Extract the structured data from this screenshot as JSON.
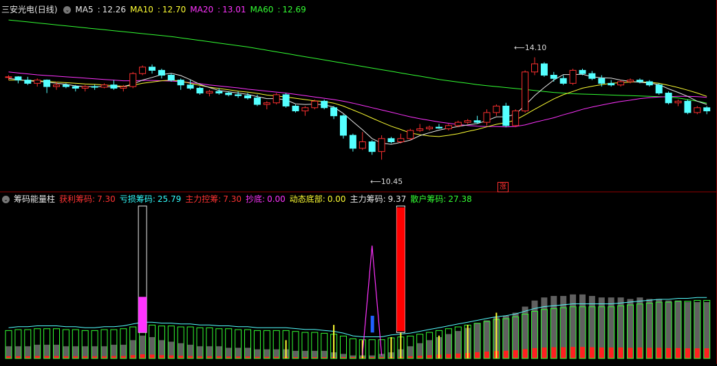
{
  "top_header": {
    "stock": "三安光电",
    "period": "(日线)",
    "ma": [
      {
        "name": "MA5",
        "value": "12.26",
        "color": "#e8e8e8"
      },
      {
        "name": "MA10",
        "value": "12.70",
        "color": "#ffff33"
      },
      {
        "name": "MA20",
        "value": "13.01",
        "color": "#ff33ff"
      },
      {
        "name": "MA60",
        "value": "12.69",
        "color": "#33ff33"
      }
    ]
  },
  "bottom_header": {
    "indicator": "筹码能量柱",
    "items": [
      {
        "name": "获利筹码",
        "value": "7.30",
        "color": "#ff3333"
      },
      {
        "name": "亏损筹码",
        "value": "25.79",
        "color": "#33ffff"
      },
      {
        "name": "主力控筹",
        "value": "7.30",
        "color": "#ff3333"
      },
      {
        "name": "抄底",
        "value": "0.00",
        "color": "#ff33ff"
      },
      {
        "name": "动态底部",
        "value": "0.00",
        "color": "#ffff33"
      },
      {
        "name": "主力筹码",
        "value": "9.37",
        "color": "#e8e8e8"
      },
      {
        "name": "散户筹码",
        "value": "27.38",
        "color": "#33ff33"
      }
    ]
  },
  "annotations": {
    "high_label": "14.10",
    "low_label": "10.45",
    "limit_up_badge": "涨"
  },
  "colors": {
    "up": "#ff3030",
    "down": "#54ffff",
    "ma5": "#e8e8e8",
    "ma10": "#ffff33",
    "ma20": "#ff33ff",
    "ma60": "#33ff33",
    "divider": "#8a0000"
  },
  "chart_data": {
    "type": "candlestick",
    "y_range": [
      10.2,
      15.4
    ],
    "candles": [
      [
        13.5,
        13.55,
        13.4,
        13.5
      ],
      [
        13.5,
        13.52,
        13.3,
        13.4
      ],
      [
        13.4,
        13.5,
        13.25,
        13.3
      ],
      [
        13.3,
        13.45,
        13.2,
        13.4
      ],
      [
        13.4,
        13.42,
        13.0,
        13.2
      ],
      [
        13.2,
        13.35,
        13.1,
        13.25
      ],
      [
        13.25,
        13.3,
        13.15,
        13.2
      ],
      [
        13.2,
        13.25,
        13.05,
        13.15
      ],
      [
        13.15,
        13.25,
        13.05,
        13.2
      ],
      [
        13.2,
        13.26,
        13.1,
        13.18
      ],
      [
        13.18,
        13.3,
        13.15,
        13.25
      ],
      [
        13.25,
        13.4,
        13.1,
        13.15
      ],
      [
        13.15,
        13.25,
        13.05,
        13.2
      ],
      [
        13.2,
        13.65,
        13.15,
        13.6
      ],
      [
        13.6,
        13.85,
        13.55,
        13.8
      ],
      [
        13.8,
        13.88,
        13.6,
        13.7
      ],
      [
        13.7,
        13.75,
        13.45,
        13.55
      ],
      [
        13.55,
        13.6,
        13.35,
        13.4
      ],
      [
        13.4,
        13.45,
        13.1,
        13.25
      ],
      [
        13.25,
        13.4,
        13.1,
        13.15
      ],
      [
        13.15,
        13.2,
        12.95,
        13.0
      ],
      [
        13.0,
        13.1,
        12.9,
        13.05
      ],
      [
        13.05,
        13.15,
        12.95,
        13.0
      ],
      [
        13.0,
        13.05,
        12.9,
        12.95
      ],
      [
        12.95,
        13.05,
        12.85,
        12.92
      ],
      [
        12.92,
        13.0,
        12.8,
        12.85
      ],
      [
        12.85,
        12.95,
        12.6,
        12.65
      ],
      [
        12.65,
        12.75,
        12.5,
        12.7
      ],
      [
        12.7,
        13.0,
        12.65,
        12.95
      ],
      [
        12.95,
        13.0,
        12.55,
        12.6
      ],
      [
        12.6,
        12.65,
        12.4,
        12.45
      ],
      [
        12.45,
        12.6,
        12.3,
        12.55
      ],
      [
        12.55,
        12.8,
        12.5,
        12.75
      ],
      [
        12.75,
        12.8,
        12.5,
        12.55
      ],
      [
        12.55,
        12.6,
        12.2,
        12.3
      ],
      [
        12.3,
        12.35,
        11.6,
        11.7
      ],
      [
        11.7,
        11.75,
        11.2,
        11.3
      ],
      [
        11.3,
        11.8,
        11.25,
        11.5
      ],
      [
        11.5,
        11.55,
        11.1,
        11.2
      ],
      [
        11.2,
        11.7,
        10.95,
        11.6
      ],
      [
        11.6,
        11.65,
        11.45,
        11.5
      ],
      [
        11.5,
        11.75,
        11.45,
        11.6
      ],
      [
        11.6,
        11.9,
        11.55,
        11.85
      ],
      [
        11.85,
        12.05,
        11.8,
        11.9
      ],
      [
        11.9,
        12.0,
        11.85,
        11.95
      ],
      [
        11.95,
        12.05,
        11.9,
        11.92
      ],
      [
        11.9,
        12.05,
        11.85,
        12.0
      ],
      [
        12.0,
        12.15,
        11.95,
        12.1
      ],
      [
        12.1,
        12.2,
        12.05,
        12.15
      ],
      [
        12.15,
        12.3,
        12.05,
        12.1
      ],
      [
        12.1,
        12.5,
        12.0,
        12.4
      ],
      [
        12.4,
        12.65,
        12.3,
        12.6
      ],
      [
        12.6,
        12.7,
        11.95,
        12.0
      ],
      [
        12.0,
        12.5,
        11.95,
        12.45
      ],
      [
        12.45,
        13.7,
        12.4,
        13.65
      ],
      [
        13.65,
        14.1,
        13.55,
        13.9
      ],
      [
        13.9,
        13.95,
        13.5,
        13.55
      ],
      [
        13.55,
        13.65,
        13.35,
        13.45
      ],
      [
        13.45,
        13.55,
        13.25,
        13.3
      ],
      [
        13.3,
        13.75,
        13.25,
        13.7
      ],
      [
        13.7,
        13.75,
        13.55,
        13.6
      ],
      [
        13.6,
        13.68,
        13.4,
        13.45
      ],
      [
        13.45,
        13.55,
        13.2,
        13.3
      ],
      [
        13.3,
        13.4,
        13.2,
        13.25
      ],
      [
        13.25,
        13.4,
        13.2,
        13.35
      ],
      [
        13.35,
        13.45,
        13.3,
        13.4
      ],
      [
        13.4,
        13.45,
        13.3,
        13.35
      ],
      [
        13.35,
        13.4,
        13.2,
        13.25
      ],
      [
        13.25,
        13.3,
        12.95,
        13.0
      ],
      [
        13.0,
        13.05,
        12.65,
        12.7
      ],
      [
        12.7,
        12.8,
        12.6,
        12.75
      ],
      [
        12.75,
        12.8,
        12.35,
        12.4
      ],
      [
        12.4,
        12.6,
        12.35,
        12.55
      ],
      [
        12.55,
        12.6,
        12.35,
        12.45
      ]
    ],
    "ma5": [
      13.45,
      13.42,
      13.38,
      13.36,
      13.34,
      13.3,
      13.27,
      13.22,
      13.2,
      13.2,
      13.2,
      13.19,
      13.2,
      13.28,
      13.4,
      13.48,
      13.57,
      13.61,
      13.54,
      13.41,
      13.27,
      13.17,
      13.08,
      13.04,
      13.0,
      12.96,
      12.89,
      12.83,
      12.83,
      12.79,
      12.67,
      12.65,
      12.66,
      12.64,
      12.57,
      12.37,
      12.12,
      11.87,
      11.6,
      11.46,
      11.42,
      11.48,
      11.55,
      11.69,
      11.78,
      11.86,
      11.92,
      11.97,
      12.02,
      12.06,
      12.15,
      12.27,
      12.27,
      12.35,
      12.62,
      12.92,
      13.17,
      13.4,
      13.57,
      13.57,
      13.58,
      13.5,
      13.47,
      13.46,
      13.4,
      13.36,
      13.33,
      13.31,
      13.26,
      13.13,
      13.02,
      12.9,
      12.75,
      12.65
    ],
    "ma10": [
      13.4,
      13.4,
      13.39,
      13.38,
      13.36,
      13.34,
      13.32,
      13.3,
      13.28,
      13.27,
      13.25,
      13.23,
      13.21,
      13.24,
      13.3,
      13.34,
      13.38,
      13.4,
      13.37,
      13.3,
      13.24,
      13.18,
      13.14,
      13.1,
      13.06,
      13.03,
      12.99,
      12.94,
      12.91,
      12.88,
      12.84,
      12.8,
      12.76,
      12.74,
      12.69,
      12.6,
      12.48,
      12.36,
      12.23,
      12.1,
      11.98,
      11.88,
      11.77,
      11.72,
      11.68,
      11.66,
      11.7,
      11.75,
      11.82,
      11.88,
      11.96,
      12.04,
      12.09,
      12.17,
      12.33,
      12.5,
      12.66,
      12.82,
      12.95,
      13.05,
      13.15,
      13.21,
      13.26,
      13.3,
      13.32,
      13.34,
      13.35,
      13.33,
      13.3,
      13.24,
      13.17,
      13.09,
      13.0,
      12.9
    ],
    "ma20": [
      13.65,
      13.62,
      13.59,
      13.56,
      13.54,
      13.52,
      13.5,
      13.48,
      13.46,
      13.44,
      13.42,
      13.4,
      13.38,
      13.38,
      13.39,
      13.39,
      13.38,
      13.37,
      13.35,
      13.32,
      13.29,
      13.25,
      13.22,
      13.19,
      13.16,
      13.12,
      13.09,
      13.06,
      13.03,
      13.0,
      12.96,
      12.92,
      12.88,
      12.84,
      12.8,
      12.75,
      12.69,
      12.62,
      12.55,
      12.48,
      12.41,
      12.34,
      12.27,
      12.21,
      12.16,
      12.11,
      12.07,
      12.03,
      12.0,
      11.98,
      11.97,
      11.97,
      11.96,
      11.97,
      12.02,
      12.1,
      12.17,
      12.24,
      12.33,
      12.41,
      12.5,
      12.57,
      12.63,
      12.69,
      12.74,
      12.78,
      12.83,
      12.86,
      12.88,
      12.89,
      12.9,
      12.9,
      12.89,
      12.87
    ],
    "ma60": [
      15.25,
      15.22,
      15.19,
      15.16,
      15.13,
      15.1,
      15.07,
      15.04,
      15.01,
      14.98,
      14.95,
      14.92,
      14.89,
      14.86,
      14.83,
      14.8,
      14.77,
      14.74,
      14.7,
      14.66,
      14.62,
      14.58,
      14.54,
      14.5,
      14.46,
      14.42,
      14.37,
      14.32,
      14.27,
      14.22,
      14.17,
      14.12,
      14.07,
      14.02,
      13.97,
      13.92,
      13.87,
      13.82,
      13.77,
      13.72,
      13.67,
      13.62,
      13.57,
      13.52,
      13.47,
      13.42,
      13.38,
      13.34,
      13.3,
      13.26,
      13.23,
      13.2,
      13.17,
      13.14,
      13.11,
      13.08,
      13.05,
      13.02,
      13.0,
      12.98,
      12.97,
      12.96,
      12.95,
      12.94,
      12.93,
      12.92,
      12.91,
      12.9,
      12.89,
      12.88,
      12.85,
      12.8,
      12.75,
      12.69
    ],
    "volume_boxes": [
      0.32,
      0.33,
      0.33,
      0.34,
      0.34,
      0.34,
      0.33,
      0.33,
      0.32,
      0.32,
      0.33,
      0.33,
      0.34,
      0.36,
      0.38,
      0.38,
      0.37,
      0.37,
      0.36,
      0.36,
      0.35,
      0.35,
      0.34,
      0.34,
      0.33,
      0.33,
      0.32,
      0.32,
      0.32,
      0.32,
      0.31,
      0.3,
      0.3,
      0.29,
      0.28,
      0.26,
      0.23,
      0.22,
      0.22,
      0.22,
      0.24,
      0.25,
      0.26,
      0.28,
      0.3,
      0.32,
      0.34,
      0.36,
      0.38,
      0.4,
      0.42,
      0.44,
      0.45,
      0.47,
      0.5,
      0.53,
      0.55,
      0.56,
      0.57,
      0.58,
      0.58,
      0.58,
      0.58,
      0.58,
      0.59,
      0.6,
      0.61,
      0.62,
      0.63,
      0.63,
      0.64,
      0.64,
      0.65,
      0.65
    ],
    "gray_fill": [
      0.08,
      0.08,
      0.08,
      0.09,
      0.09,
      0.09,
      0.08,
      0.08,
      0.08,
      0.08,
      0.08,
      0.09,
      0.09,
      0.12,
      0.15,
      0.14,
      0.12,
      0.11,
      0.1,
      0.09,
      0.08,
      0.08,
      0.08,
      0.07,
      0.07,
      0.07,
      0.06,
      0.06,
      0.06,
      0.06,
      0.05,
      0.05,
      0.05,
      0.05,
      0.04,
      0.03,
      0.02,
      0.02,
      0.02,
      0.03,
      0.04,
      0.06,
      0.08,
      0.1,
      0.12,
      0.14,
      0.16,
      0.18,
      0.2,
      0.23,
      0.25,
      0.27,
      0.28,
      0.3,
      0.34,
      0.38,
      0.4,
      0.41,
      0.41,
      0.42,
      0.42,
      0.41,
      0.4,
      0.4,
      0.4,
      0.39,
      0.4,
      0.39,
      0.39,
      0.38,
      0.38,
      0.37,
      0.37,
      0.37
    ],
    "yellow_spikes": [
      [
        29,
        0.12
      ],
      [
        34,
        0.22
      ],
      [
        37,
        0.12
      ],
      [
        40,
        0.14
      ],
      [
        41,
        0.42
      ],
      [
        45,
        0.15
      ],
      [
        48,
        0.22
      ],
      [
        51,
        0.3
      ]
    ],
    "big_bars": [
      {
        "i": 14,
        "color": "#ff33ff",
        "fill": 0.26
      },
      {
        "i": 41,
        "color": "#ff0000",
        "fill": 0.95
      }
    ],
    "magenta_peak": {
      "i": 38,
      "value": 0.74
    },
    "blue_bar": {
      "i": 38,
      "value": 0.28
    }
  }
}
